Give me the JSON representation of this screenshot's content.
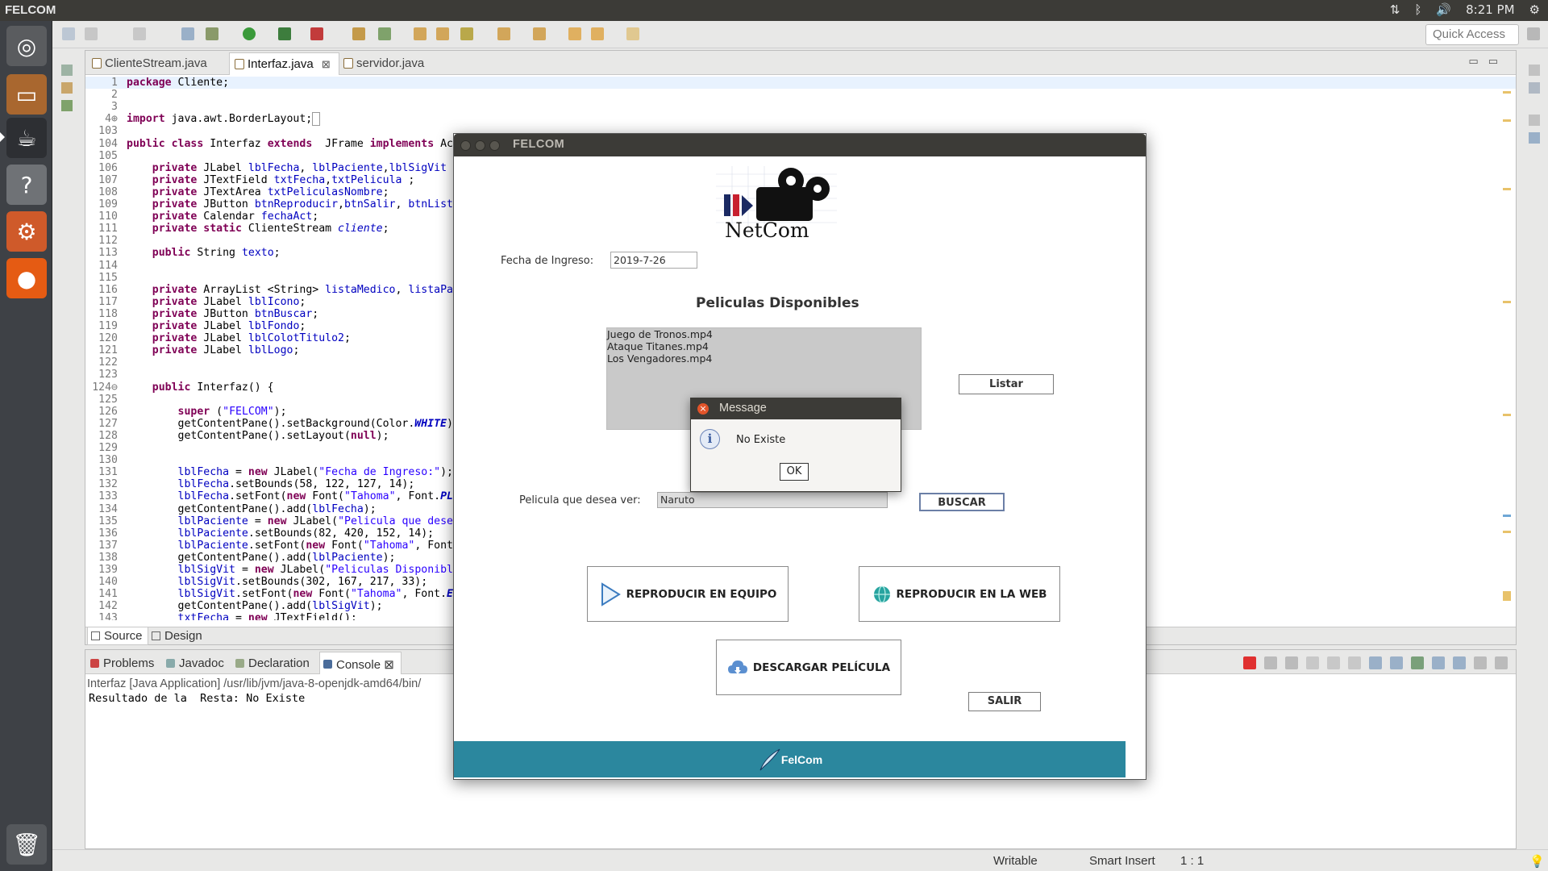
{
  "top_panel": {
    "app_title": "FELCOM",
    "time": "8:21 PM"
  },
  "launcher": {
    "items": [
      "ubuntu-dash-icon",
      "files-icon",
      "eclipse-icon",
      "help-icon",
      "system-settings-icon",
      "firefox-icon",
      "trash-icon"
    ]
  },
  "toolbar": {
    "quick_access": "Quick Access"
  },
  "editor": {
    "tabs": [
      {
        "label": "ClienteStream.java",
        "close": ""
      },
      {
        "label": "Interfaz.java",
        "close": "⊠"
      },
      {
        "label": "servidor.java",
        "close": ""
      }
    ],
    "lines": [
      {
        "n": "1",
        "html": "<span class=\"kw\">package</span> Cliente;"
      },
      {
        "n": "2",
        "html": ""
      },
      {
        "n": "3",
        "html": ""
      },
      {
        "n": "4⊕",
        "html": "<span class=\"kw\">import</span> java.awt.BorderLayout;<span style=\"border:1px solid #999\">&nbsp;</span>"
      },
      {
        "n": "103",
        "html": ""
      },
      {
        "n": "104",
        "html": "<span class=\"kw\">public class</span> Interfaz <span class=\"kw\">extends</span>  JFrame <span class=\"kw\">implements</span> Ac"
      },
      {
        "n": "105",
        "html": ""
      },
      {
        "n": "106",
        "html": "    <span class=\"kw\">private</span> JLabel <span class=\"fld\">lblFecha</span>, <span class=\"fld\">lblPaciente</span>,<span class=\"fld\">lblSigVit</span>"
      },
      {
        "n": "107",
        "html": "    <span class=\"kw\">private</span> JTextField <span class=\"fld\">txtFecha</span>,<span class=\"fld\">txtPelicula</span> ;"
      },
      {
        "n": "108",
        "html": "    <span class=\"kw\">private</span> JTextArea <span class=\"fld\">txtPeliculasNombre</span>;"
      },
      {
        "n": "109",
        "html": "    <span class=\"kw\">private</span> JButton <span class=\"fld\">btnReproducir</span>,<span class=\"fld\">btnSalir</span>, <span class=\"fld\">btnList</span>"
      },
      {
        "n": "110",
        "html": "    <span class=\"kw\">private</span> Calendar <span class=\"fld\">fechaAct</span>;"
      },
      {
        "n": "111",
        "html": "    <span class=\"kw\">private static</span> ClienteStream <span class=\"ifld\">cliente</span>;"
      },
      {
        "n": "112",
        "html": ""
      },
      {
        "n": "113",
        "html": "    <span class=\"kw\">public</span> String <span class=\"fld\">texto</span>;"
      },
      {
        "n": "114",
        "html": ""
      },
      {
        "n": "115",
        "html": ""
      },
      {
        "n": "116",
        "html": "    <span class=\"kw\">private</span> ArrayList &lt;String&gt; <span class=\"fld\">listaMedico</span>, <span class=\"fld\">listaPa</span>"
      },
      {
        "n": "117",
        "html": "    <span class=\"kw\">private</span> JLabel <span class=\"fld\">lblIcono</span>;"
      },
      {
        "n": "118",
        "html": "    <span class=\"kw\">private</span> JButton <span class=\"fld\">btnBuscar</span>;"
      },
      {
        "n": "119",
        "html": "    <span class=\"kw\">private</span> JLabel <span class=\"fld\">lblFondo</span>;"
      },
      {
        "n": "120",
        "html": "    <span class=\"kw\">private</span> JLabel <span class=\"fld\">lblColotTitulo2</span>;"
      },
      {
        "n": "121",
        "html": "    <span class=\"kw\">private</span> JLabel <span class=\"fld\">lblLogo</span>;"
      },
      {
        "n": "122",
        "html": ""
      },
      {
        "n": "123",
        "html": ""
      },
      {
        "n": "124⊖",
        "html": "    <span class=\"kw\">public</span> Interfaz() {"
      },
      {
        "n": "125",
        "html": ""
      },
      {
        "n": "126",
        "html": "        <span class=\"kw\">super</span> (<span class=\"str\">\"FELCOM\"</span>);"
      },
      {
        "n": "127",
        "html": "        getContentPane().setBackground(Color.<span class=\"ifld\" style=\"font-weight:bold\">WHITE</span>)"
      },
      {
        "n": "128",
        "html": "        getContentPane().setLayout(<span class=\"kw\">null</span>);"
      },
      {
        "n": "129",
        "html": ""
      },
      {
        "n": "130",
        "html": ""
      },
      {
        "n": "131",
        "html": "        <span class=\"fld\">lblFecha</span> = <span class=\"kw\">new</span> JLabel(<span class=\"str\">\"Fecha de Ingreso:\"</span>);"
      },
      {
        "n": "132",
        "html": "        <span class=\"fld\">lblFecha</span>.setBounds(58, 122, 127, 14);"
      },
      {
        "n": "133",
        "html": "        <span class=\"fld\">lblFecha</span>.setFont(<span class=\"kw\">new</span> Font(<span class=\"str\">\"Tahoma\"</span>, Font.<span class=\"ifld\" style=\"font-weight:bold\">PL</span>"
      },
      {
        "n": "134",
        "html": "        getContentPane().add(<span class=\"fld\">lblFecha</span>);"
      },
      {
        "n": "135",
        "html": "        <span class=\"fld\">lblPaciente</span> = <span class=\"kw\">new</span> JLabel(<span class=\"str\">\"Pelicula que dese</span>"
      },
      {
        "n": "136",
        "html": "        <span class=\"fld\">lblPaciente</span>.setBounds(82, 420, 152, 14);"
      },
      {
        "n": "137",
        "html": "        <span class=\"fld\">lblPaciente</span>.setFont(<span class=\"kw\">new</span> Font(<span class=\"str\">\"Tahoma\"</span>, Font"
      },
      {
        "n": "138",
        "html": "        getContentPane().add(<span class=\"fld\">lblPaciente</span>);"
      },
      {
        "n": "139",
        "html": "        <span class=\"fld\">lblSigVit</span> = <span class=\"kw\">new</span> JLabel(<span class=\"str\">\"Peliculas Disponibl</span>"
      },
      {
        "n": "140",
        "html": "        <span class=\"fld\">lblSigVit</span>.setBounds(302, 167, 217, 33);"
      },
      {
        "n": "141",
        "html": "        <span class=\"fld\">lblSigVit</span>.setFont(<span class=\"kw\">new</span> Font(<span class=\"str\">\"Tahoma\"</span>, Font.<span class=\"ifld\" style=\"font-weight:bold\">E</span>"
      },
      {
        "n": "142",
        "html": "        getContentPane().add(<span class=\"fld\">lblSigVit</span>);"
      },
      {
        "n": "143",
        "html": "        <span class=\"fld\">txtFecha</span> = <span class=\"kw\">new</span> JTextField();"
      }
    ],
    "bottom_tabs": [
      "Source",
      "Design"
    ]
  },
  "console": {
    "tabs": [
      {
        "label": "Problems",
        "close": ""
      },
      {
        "label": "Javadoc",
        "close": ""
      },
      {
        "label": "Declaration",
        "close": ""
      },
      {
        "label": "Console",
        "close": "⊠"
      }
    ],
    "description": "Interfaz [Java Application] /usr/lib/jvm/java-8-openjdk-amd64/bin/",
    "output": "Resultado de la  Resta: No Existe"
  },
  "status_bar": {
    "mode": "Writable",
    "insert": "Smart Insert",
    "position": "1 : 1"
  },
  "felcom": {
    "title": "FELCOM",
    "logo_text": "NetCom",
    "fecha_label": "Fecha de Ingreso:",
    "fecha_value": "2019-7-26",
    "peliculas_title": "Peliculas Disponibles",
    "movies": [
      "Juego de Tronos.mp4",
      "Ataque Titanes.mp4",
      "Los Vengadores.mp4"
    ],
    "listar_button": "Listar",
    "pelicula_label": "Pelicula que desea ver:",
    "pelicula_value": "Naruto",
    "buscar_button": "BUSCAR",
    "reproducir_equipo_button": "REPRODUCIR EN EQUIPO",
    "reproducir_web_button": "REPRODUCIR EN LA WEB",
    "descargar_button": "DESCARGAR PELÍCULA",
    "salir_button": "SALIR",
    "footer_text": "FelCom"
  },
  "dialog": {
    "title": "Message",
    "message": "No Existe",
    "ok_button": "OK"
  },
  "colors": {
    "footer_teal": "#2b879e",
    "panel_dark": "#3c3b37",
    "keyword": "#7f0055",
    "string": "#2a00ff",
    "field": "#0000c0"
  }
}
